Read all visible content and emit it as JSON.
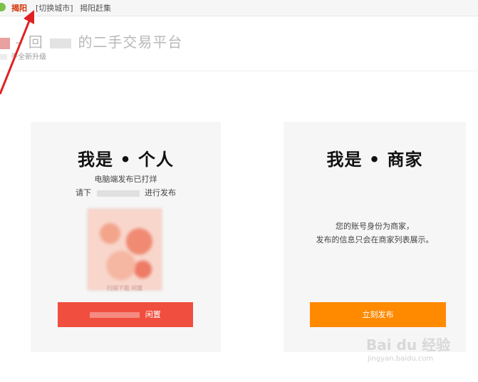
{
  "topbar": {
    "city": "揭阳",
    "switch_city": "[切换城市]",
    "nearby": "揭阳赶集"
  },
  "header": {
    "title_prefix": "– 回",
    "title_suffix": "的二手交易平台",
    "subtitle": "手全新升级"
  },
  "cards": {
    "personal": {
      "title": "我是 • 个人",
      "line1": "电脑端发布已打烊",
      "line2_prefix": "请下",
      "line2_suffix": "进行发布",
      "qr_caption": "扫描下载 闲置",
      "button_suffix": "闲置"
    },
    "merchant": {
      "title": "我是 • 商家",
      "desc_line1": "您的账号身份为商家，",
      "desc_line2": "发布的信息只会在商家列表展示。",
      "button": "立刻发布"
    }
  },
  "watermark": {
    "brand": "Bai du 经验",
    "url": "jingyan.baidu.com"
  },
  "colors": {
    "accent_red": "#f04e3e",
    "accent_orange": "#ff8a00",
    "arrow_red": "#e02020"
  }
}
